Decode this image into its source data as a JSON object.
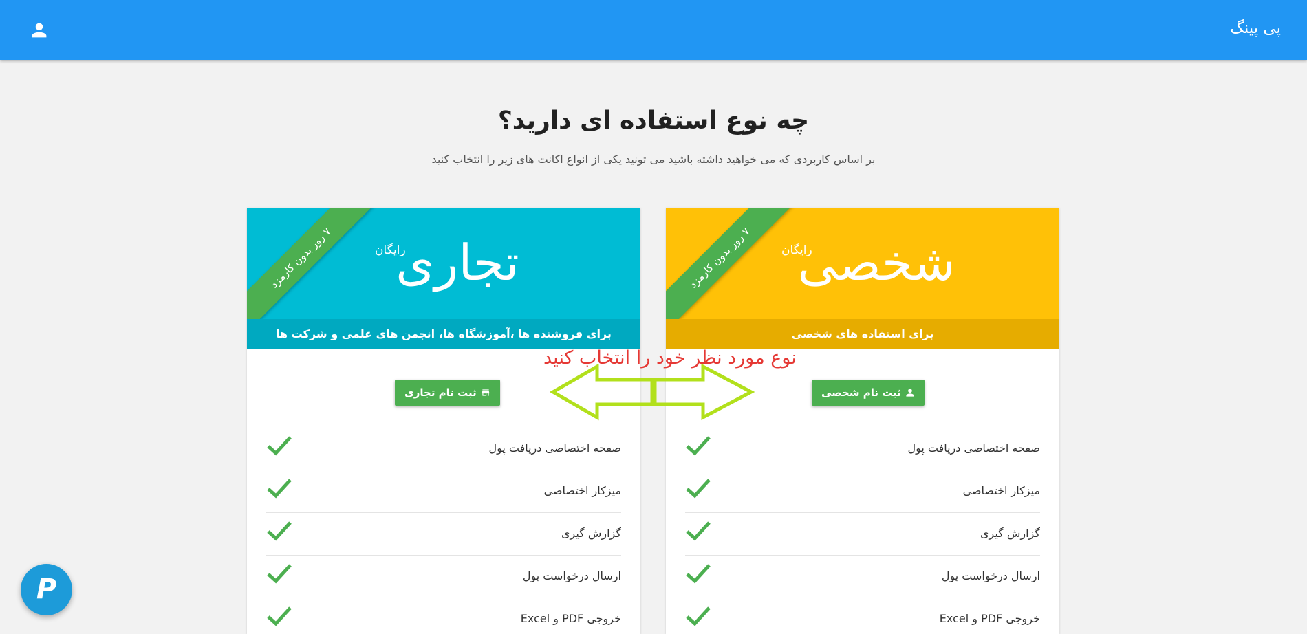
{
  "header": {
    "brand": "پی پینگ",
    "icon": "user-icon",
    "color": "#2196f3"
  },
  "intro": {
    "title": "چه نوع استفاده ای دارید؟",
    "subtitle": "بر اساس کاربردی که می خواهید داشته باشید می تونید یکی از انواع اکانت های زیر را انتخاب کنید"
  },
  "annotation": "نوع مورد نظر خود را انتخاب کنید",
  "plans": [
    {
      "title": "شخصی",
      "free_tag": "رایگان",
      "ribbon": "۷ روز بدون کارمزد",
      "description": "برای استفاده های شخصی",
      "button": "ثبت نام شخصی",
      "button_icon": "person-icon",
      "color": "#ffc107"
    },
    {
      "title": "تجاری",
      "free_tag": "رایگان",
      "ribbon": "۷ روز بدون کارمزد",
      "description": "برای فروشنده ها ،آموزشگاه ها، انجمن های علمی و شرکت ها",
      "button": "ثبت نام تجاری",
      "button_icon": "store-icon",
      "color": "#00bcd4"
    }
  ],
  "features": [
    "صفحه اختصاصی دریافت پول",
    "میزکار اختصاصی",
    "گزارش گیری",
    "ارسال درخواست پول",
    "خروجی PDF و Excel"
  ],
  "fab": {
    "label": "P",
    "icon": "payping-logo-icon"
  }
}
